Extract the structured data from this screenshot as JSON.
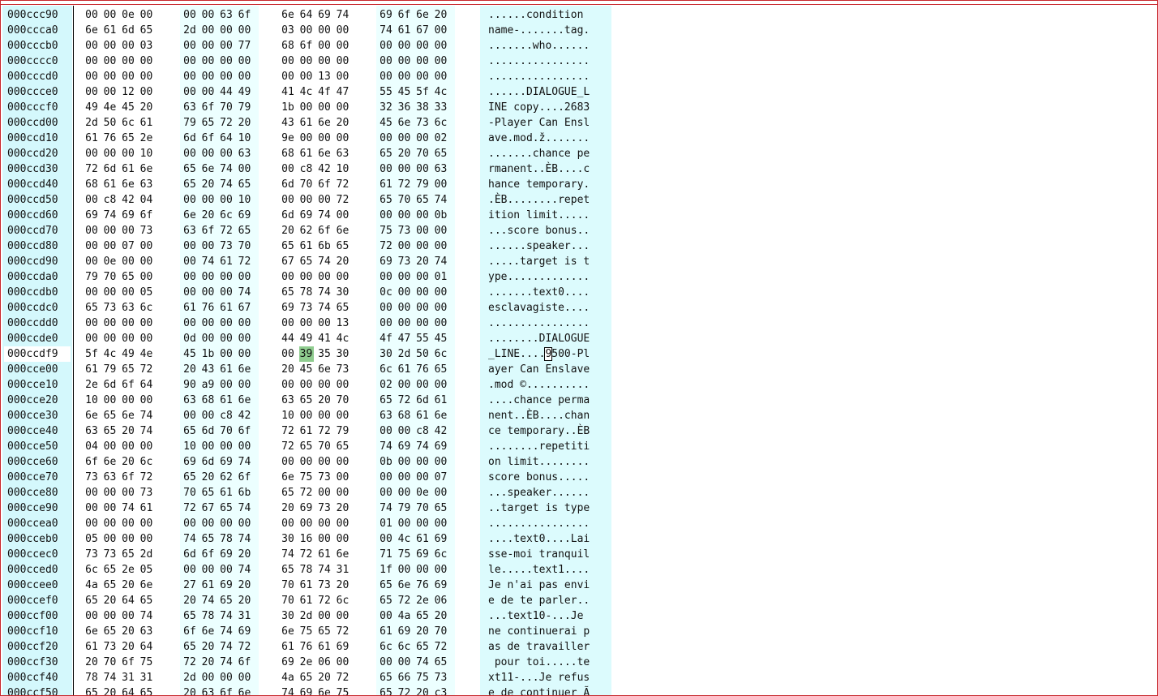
{
  "hex_view": {
    "selection": {
      "row": 22,
      "byte": 9
    },
    "rows": [
      {
        "offset": "000ccc90",
        "bytes": [
          "00",
          "00",
          "0e",
          "00",
          "00",
          "00",
          "63",
          "6f",
          "6e",
          "64",
          "69",
          "74",
          "69",
          "6f",
          "6e",
          "20"
        ],
        "ascii": "......condition "
      },
      {
        "offset": "000ccca0",
        "bytes": [
          "6e",
          "61",
          "6d",
          "65",
          "2d",
          "00",
          "00",
          "00",
          "03",
          "00",
          "00",
          "00",
          "74",
          "61",
          "67",
          "00"
        ],
        "ascii": "name-.......tag."
      },
      {
        "offset": "000cccb0",
        "bytes": [
          "00",
          "00",
          "00",
          "03",
          "00",
          "00",
          "00",
          "77",
          "68",
          "6f",
          "00",
          "00",
          "00",
          "00",
          "00",
          "00"
        ],
        "ascii": ".......who......"
      },
      {
        "offset": "000cccc0",
        "bytes": [
          "00",
          "00",
          "00",
          "00",
          "00",
          "00",
          "00",
          "00",
          "00",
          "00",
          "00",
          "00",
          "00",
          "00",
          "00",
          "00"
        ],
        "ascii": "................"
      },
      {
        "offset": "000cccd0",
        "bytes": [
          "00",
          "00",
          "00",
          "00",
          "00",
          "00",
          "00",
          "00",
          "00",
          "00",
          "13",
          "00",
          "00",
          "00",
          "00",
          "00"
        ],
        "ascii": "................"
      },
      {
        "offset": "000ccce0",
        "bytes": [
          "00",
          "00",
          "12",
          "00",
          "00",
          "00",
          "44",
          "49",
          "41",
          "4c",
          "4f",
          "47",
          "55",
          "45",
          "5f",
          "4c"
        ],
        "ascii": "......DIALOGUE_L"
      },
      {
        "offset": "000cccf0",
        "bytes": [
          "49",
          "4e",
          "45",
          "20",
          "63",
          "6f",
          "70",
          "79",
          "1b",
          "00",
          "00",
          "00",
          "32",
          "36",
          "38",
          "33"
        ],
        "ascii": "INE copy....2683"
      },
      {
        "offset": "000ccd00",
        "bytes": [
          "2d",
          "50",
          "6c",
          "61",
          "79",
          "65",
          "72",
          "20",
          "43",
          "61",
          "6e",
          "20",
          "45",
          "6e",
          "73",
          "6c"
        ],
        "ascii": "-Player Can Ensl"
      },
      {
        "offset": "000ccd10",
        "bytes": [
          "61",
          "76",
          "65",
          "2e",
          "6d",
          "6f",
          "64",
          "10",
          "9e",
          "00",
          "00",
          "00",
          "00",
          "00",
          "00",
          "02"
        ],
        "ascii": "ave.mod.ž......."
      },
      {
        "offset": "000ccd20",
        "bytes": [
          "00",
          "00",
          "00",
          "10",
          "00",
          "00",
          "00",
          "63",
          "68",
          "61",
          "6e",
          "63",
          "65",
          "20",
          "70",
          "65"
        ],
        "ascii": ".......chance pe"
      },
      {
        "offset": "000ccd30",
        "bytes": [
          "72",
          "6d",
          "61",
          "6e",
          "65",
          "6e",
          "74",
          "00",
          "00",
          "c8",
          "42",
          "10",
          "00",
          "00",
          "00",
          "63"
        ],
        "ascii": "rmanent..ÈB....c"
      },
      {
        "offset": "000ccd40",
        "bytes": [
          "68",
          "61",
          "6e",
          "63",
          "65",
          "20",
          "74",
          "65",
          "6d",
          "70",
          "6f",
          "72",
          "61",
          "72",
          "79",
          "00"
        ],
        "ascii": "hance temporary."
      },
      {
        "offset": "000ccd50",
        "bytes": [
          "00",
          "c8",
          "42",
          "04",
          "00",
          "00",
          "00",
          "10",
          "00",
          "00",
          "00",
          "72",
          "65",
          "70",
          "65",
          "74"
        ],
        "ascii": ".ÈB........repet"
      },
      {
        "offset": "000ccd60",
        "bytes": [
          "69",
          "74",
          "69",
          "6f",
          "6e",
          "20",
          "6c",
          "69",
          "6d",
          "69",
          "74",
          "00",
          "00",
          "00",
          "00",
          "0b"
        ],
        "ascii": "ition limit....."
      },
      {
        "offset": "000ccd70",
        "bytes": [
          "00",
          "00",
          "00",
          "73",
          "63",
          "6f",
          "72",
          "65",
          "20",
          "62",
          "6f",
          "6e",
          "75",
          "73",
          "00",
          "00"
        ],
        "ascii": "...score bonus.."
      },
      {
        "offset": "000ccd80",
        "bytes": [
          "00",
          "00",
          "07",
          "00",
          "00",
          "00",
          "73",
          "70",
          "65",
          "61",
          "6b",
          "65",
          "72",
          "00",
          "00",
          "00"
        ],
        "ascii": "......speaker..."
      },
      {
        "offset": "000ccd90",
        "bytes": [
          "00",
          "0e",
          "00",
          "00",
          "00",
          "74",
          "61",
          "72",
          "67",
          "65",
          "74",
          "20",
          "69",
          "73",
          "20",
          "74"
        ],
        "ascii": ".....target is t"
      },
      {
        "offset": "000ccda0",
        "bytes": [
          "79",
          "70",
          "65",
          "00",
          "00",
          "00",
          "00",
          "00",
          "00",
          "00",
          "00",
          "00",
          "00",
          "00",
          "00",
          "01"
        ],
        "ascii": "ype............."
      },
      {
        "offset": "000ccdb0",
        "bytes": [
          "00",
          "00",
          "00",
          "05",
          "00",
          "00",
          "00",
          "74",
          "65",
          "78",
          "74",
          "30",
          "0c",
          "00",
          "00",
          "00"
        ],
        "ascii": ".......text0...."
      },
      {
        "offset": "000ccdc0",
        "bytes": [
          "65",
          "73",
          "63",
          "6c",
          "61",
          "76",
          "61",
          "67",
          "69",
          "73",
          "74",
          "65",
          "00",
          "00",
          "00",
          "00"
        ],
        "ascii": "esclavagiste...."
      },
      {
        "offset": "000ccdd0",
        "bytes": [
          "00",
          "00",
          "00",
          "00",
          "00",
          "00",
          "00",
          "00",
          "00",
          "00",
          "00",
          "13",
          "00",
          "00",
          "00",
          "00"
        ],
        "ascii": "................"
      },
      {
        "offset": "000ccde0",
        "bytes": [
          "00",
          "00",
          "00",
          "00",
          "0d",
          "00",
          "00",
          "00",
          "44",
          "49",
          "41",
          "4c",
          "4f",
          "47",
          "55",
          "45"
        ],
        "ascii": "........DIALOGUE"
      },
      {
        "offset": "000ccdf9",
        "bytes": [
          "5f",
          "4c",
          "49",
          "4e",
          "45",
          "1b",
          "00",
          "00",
          "00",
          "39",
          "35",
          "30",
          "30",
          "2d",
          "50",
          "6c"
        ],
        "ascii": "_LINE....9500-Pl"
      },
      {
        "offset": "000cce00",
        "bytes": [
          "61",
          "79",
          "65",
          "72",
          "20",
          "43",
          "61",
          "6e",
          "20",
          "45",
          "6e",
          "73",
          "6c",
          "61",
          "76",
          "65"
        ],
        "ascii": "ayer Can Enslave"
      },
      {
        "offset": "000cce10",
        "bytes": [
          "2e",
          "6d",
          "6f",
          "64",
          "90",
          "a9",
          "00",
          "00",
          "00",
          "00",
          "00",
          "00",
          "02",
          "00",
          "00",
          "00"
        ],
        "ascii": ".mod ©.........."
      },
      {
        "offset": "000cce20",
        "bytes": [
          "10",
          "00",
          "00",
          "00",
          "63",
          "68",
          "61",
          "6e",
          "63",
          "65",
          "20",
          "70",
          "65",
          "72",
          "6d",
          "61"
        ],
        "ascii": "....chance perma"
      },
      {
        "offset": "000cce30",
        "bytes": [
          "6e",
          "65",
          "6e",
          "74",
          "00",
          "00",
          "c8",
          "42",
          "10",
          "00",
          "00",
          "00",
          "63",
          "68",
          "61",
          "6e"
        ],
        "ascii": "nent..ÈB....chan"
      },
      {
        "offset": "000cce40",
        "bytes": [
          "63",
          "65",
          "20",
          "74",
          "65",
          "6d",
          "70",
          "6f",
          "72",
          "61",
          "72",
          "79",
          "00",
          "00",
          "c8",
          "42"
        ],
        "ascii": "ce temporary..ÈB"
      },
      {
        "offset": "000cce50",
        "bytes": [
          "04",
          "00",
          "00",
          "00",
          "10",
          "00",
          "00",
          "00",
          "72",
          "65",
          "70",
          "65",
          "74",
          "69",
          "74",
          "69"
        ],
        "ascii": "........repetiti"
      },
      {
        "offset": "000cce60",
        "bytes": [
          "6f",
          "6e",
          "20",
          "6c",
          "69",
          "6d",
          "69",
          "74",
          "00",
          "00",
          "00",
          "00",
          "0b",
          "00",
          "00",
          "00"
        ],
        "ascii": "on limit........"
      },
      {
        "offset": "000cce70",
        "bytes": [
          "73",
          "63",
          "6f",
          "72",
          "65",
          "20",
          "62",
          "6f",
          "6e",
          "75",
          "73",
          "00",
          "00",
          "00",
          "00",
          "07"
        ],
        "ascii": "score bonus....."
      },
      {
        "offset": "000cce80",
        "bytes": [
          "00",
          "00",
          "00",
          "73",
          "70",
          "65",
          "61",
          "6b",
          "65",
          "72",
          "00",
          "00",
          "00",
          "00",
          "0e",
          "00"
        ],
        "ascii": "...speaker......"
      },
      {
        "offset": "000cce90",
        "bytes": [
          "00",
          "00",
          "74",
          "61",
          "72",
          "67",
          "65",
          "74",
          "20",
          "69",
          "73",
          "20",
          "74",
          "79",
          "70",
          "65"
        ],
        "ascii": "..target is type"
      },
      {
        "offset": "000ccea0",
        "bytes": [
          "00",
          "00",
          "00",
          "00",
          "00",
          "00",
          "00",
          "00",
          "00",
          "00",
          "00",
          "00",
          "01",
          "00",
          "00",
          "00"
        ],
        "ascii": "................"
      },
      {
        "offset": "000cceb0",
        "bytes": [
          "05",
          "00",
          "00",
          "00",
          "74",
          "65",
          "78",
          "74",
          "30",
          "16",
          "00",
          "00",
          "00",
          "4c",
          "61",
          "69"
        ],
        "ascii": "....text0....Lai"
      },
      {
        "offset": "000ccec0",
        "bytes": [
          "73",
          "73",
          "65",
          "2d",
          "6d",
          "6f",
          "69",
          "20",
          "74",
          "72",
          "61",
          "6e",
          "71",
          "75",
          "69",
          "6c"
        ],
        "ascii": "sse-moi tranquil"
      },
      {
        "offset": "000cced0",
        "bytes": [
          "6c",
          "65",
          "2e",
          "05",
          "00",
          "00",
          "00",
          "74",
          "65",
          "78",
          "74",
          "31",
          "1f",
          "00",
          "00",
          "00"
        ],
        "ascii": "le.....text1...."
      },
      {
        "offset": "000ccee0",
        "bytes": [
          "4a",
          "65",
          "20",
          "6e",
          "27",
          "61",
          "69",
          "20",
          "70",
          "61",
          "73",
          "20",
          "65",
          "6e",
          "76",
          "69"
        ],
        "ascii": "Je n'ai pas envi"
      },
      {
        "offset": "000ccef0",
        "bytes": [
          "65",
          "20",
          "64",
          "65",
          "20",
          "74",
          "65",
          "20",
          "70",
          "61",
          "72",
          "6c",
          "65",
          "72",
          "2e",
          "06"
        ],
        "ascii": "e de te parler.."
      },
      {
        "offset": "000ccf00",
        "bytes": [
          "00",
          "00",
          "00",
          "74",
          "65",
          "78",
          "74",
          "31",
          "30",
          "2d",
          "00",
          "00",
          "00",
          "4a",
          "65",
          "20"
        ],
        "ascii": "...text10-...Je "
      },
      {
        "offset": "000ccf10",
        "bytes": [
          "6e",
          "65",
          "20",
          "63",
          "6f",
          "6e",
          "74",
          "69",
          "6e",
          "75",
          "65",
          "72",
          "61",
          "69",
          "20",
          "70"
        ],
        "ascii": "ne continuerai p"
      },
      {
        "offset": "000ccf20",
        "bytes": [
          "61",
          "73",
          "20",
          "64",
          "65",
          "20",
          "74",
          "72",
          "61",
          "76",
          "61",
          "69",
          "6c",
          "6c",
          "65",
          "72"
        ],
        "ascii": "as de travailler"
      },
      {
        "offset": "000ccf30",
        "bytes": [
          "20",
          "70",
          "6f",
          "75",
          "72",
          "20",
          "74",
          "6f",
          "69",
          "2e",
          "06",
          "00",
          "00",
          "00",
          "74",
          "65"
        ],
        "ascii": " pour toi.....te"
      },
      {
        "offset": "000ccf40",
        "bytes": [
          "78",
          "74",
          "31",
          "31",
          "2d",
          "00",
          "00",
          "00",
          "4a",
          "65",
          "20",
          "72",
          "65",
          "66",
          "75",
          "73"
        ],
        "ascii": "xt11-...Je refus"
      },
      {
        "offset": "000ccf50",
        "bytes": [
          "65",
          "20",
          "64",
          "65",
          "20",
          "63",
          "6f",
          "6e",
          "74",
          "69",
          "6e",
          "75",
          "65",
          "72",
          "20",
          "c3"
        ],
        "ascii": "e de continuer Ã"
      }
    ]
  }
}
